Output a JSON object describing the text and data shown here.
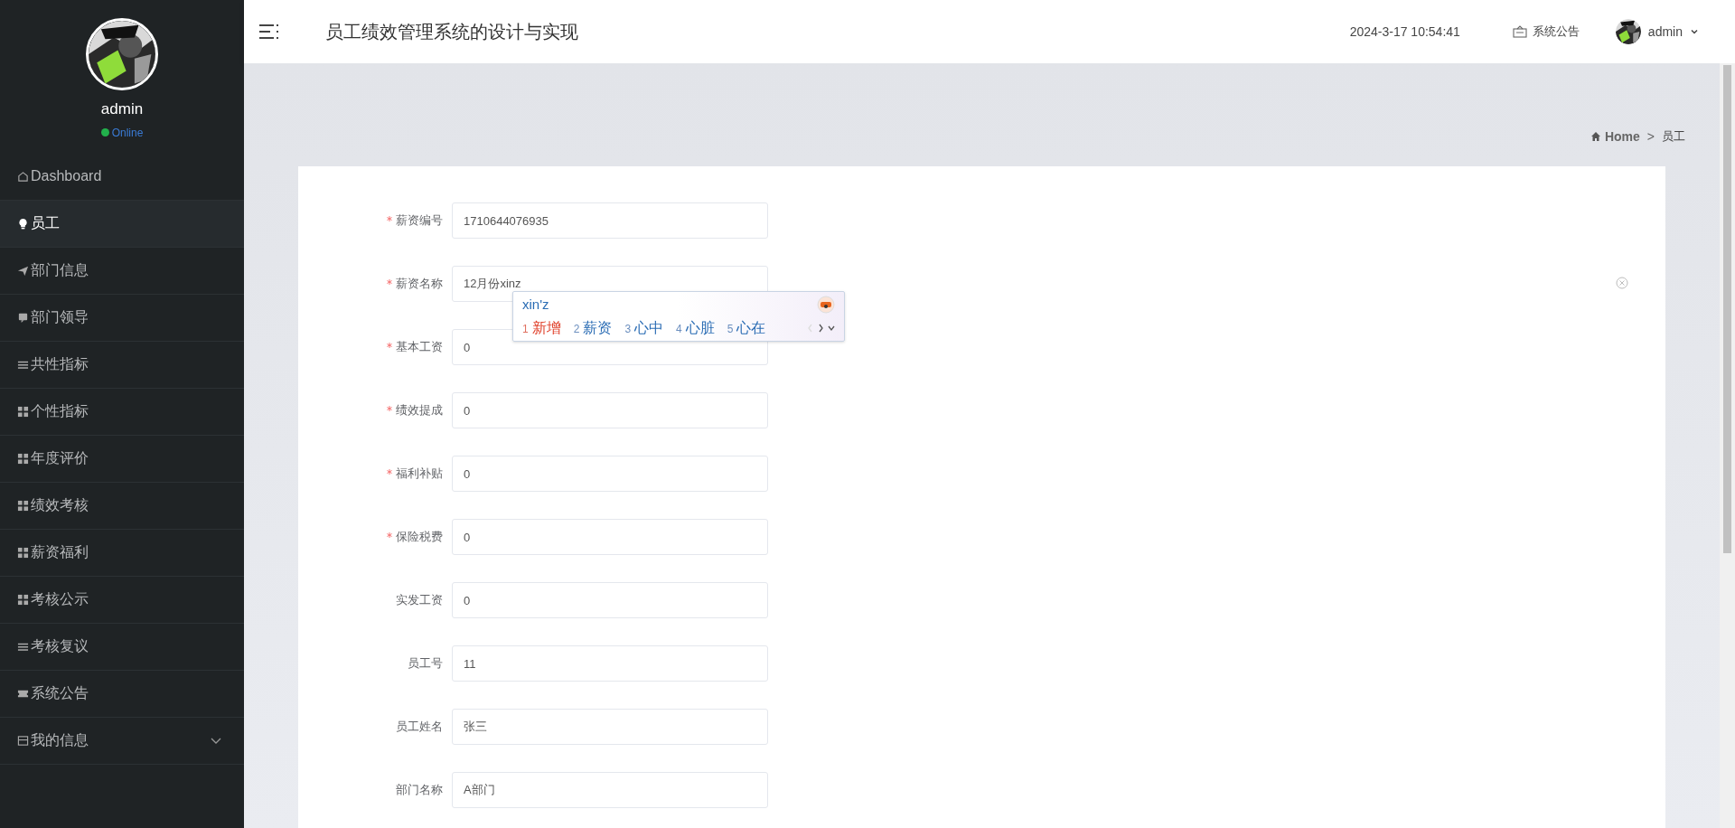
{
  "sidebar": {
    "user": {
      "name": "admin",
      "status": "Online"
    },
    "items": [
      {
        "label": "Dashboard",
        "selected": false
      },
      {
        "label": "员工",
        "selected": true
      },
      {
        "label": "部门信息",
        "selected": false
      },
      {
        "label": "部门领导",
        "selected": false
      },
      {
        "label": "共性指标",
        "selected": false
      },
      {
        "label": "个性指标",
        "selected": false
      },
      {
        "label": "年度评价",
        "selected": false
      },
      {
        "label": "绩效考核",
        "selected": false
      },
      {
        "label": "薪资福利",
        "selected": false
      },
      {
        "label": "考核公示",
        "selected": false
      },
      {
        "label": "考核复议",
        "selected": false
      },
      {
        "label": "系统公告",
        "selected": false
      },
      {
        "label": "我的信息",
        "selected": false,
        "expanded": false
      }
    ]
  },
  "header": {
    "title": "员工绩效管理系统的设计与实现",
    "datetime": "2024-3-17 10:54:41",
    "notice": "系统公告",
    "user": "admin"
  },
  "breadcrumb": {
    "items": [
      "Home",
      "员工"
    ],
    "separator": ">"
  },
  "form": {
    "fields": [
      {
        "label": "薪资编号",
        "required": true,
        "value": "1710644076935"
      },
      {
        "label": "薪资名称",
        "required": true,
        "value": "12月份xinz"
      },
      {
        "label": "基本工资",
        "required": true,
        "value": "0"
      },
      {
        "label": "绩效提成",
        "required": true,
        "value": "0"
      },
      {
        "label": "福利补贴",
        "required": true,
        "value": "0"
      },
      {
        "label": "保险税费",
        "required": true,
        "value": "0"
      },
      {
        "label": "实发工资",
        "required": false,
        "value": "0"
      },
      {
        "label": "员工号",
        "required": false,
        "value": "11"
      },
      {
        "label": "员工姓名",
        "required": false,
        "value": "张三"
      },
      {
        "label": "部门名称",
        "required": false,
        "value": "A部门"
      }
    ]
  },
  "ime": {
    "composition": "xin'z",
    "candidates": [
      {
        "index": "1",
        "text": "新增",
        "selected": true
      },
      {
        "index": "2",
        "text": "薪资",
        "selected": false
      },
      {
        "index": "3",
        "text": "心中",
        "selected": false
      },
      {
        "index": "4",
        "text": "心脏",
        "selected": false
      },
      {
        "index": "5",
        "text": "心在",
        "selected": false
      }
    ]
  }
}
